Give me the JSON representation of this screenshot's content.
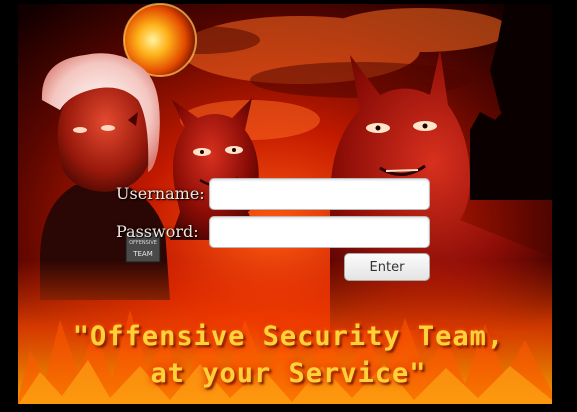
{
  "login": {
    "username_label": "Username:",
    "password_label": "Password:",
    "username_value": "",
    "password_value": "",
    "enter_label": "Enter"
  },
  "slogan": {
    "line1": "\"Offensive Security Team,",
    "line2": "at your Service\""
  },
  "badge": {
    "text_top": "OFFENSIVE",
    "text_bottom": "TEAM"
  },
  "colors": {
    "background": "#000000",
    "flame_red": "#c41a00",
    "slogan_yellow": "#ffd23a"
  }
}
